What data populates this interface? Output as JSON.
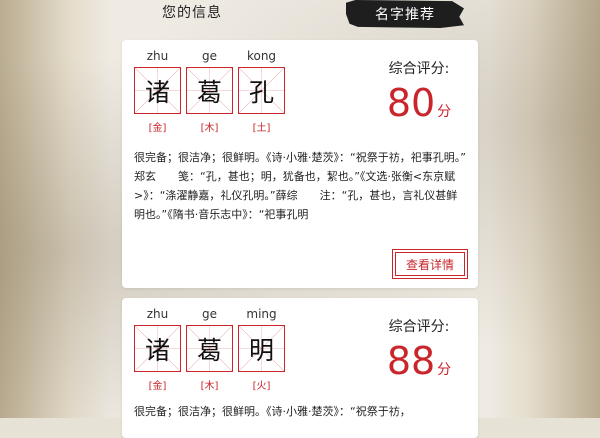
{
  "tabs": {
    "info_label": "您的信息",
    "recommend_label": "名字推荐"
  },
  "colors": {
    "accent_red": "#c9252b",
    "tab_dark": "#1e1e1e"
  },
  "cards": [
    {
      "chars": [
        {
          "pinyin": "zhu",
          "char": "诸",
          "element": "[金]"
        },
        {
          "pinyin": "ge",
          "char": "葛",
          "element": "[木]"
        },
        {
          "pinyin": "kong",
          "char": "孔",
          "element": "[土]"
        }
      ],
      "score_label": "综合评分:",
      "score": "80",
      "score_unit": "分",
      "description": "很完备；很洁净；很鲜明。《诗·小雅·楚茨》：“祝祭于祊，祀事孔明。”　　郑玄　　笺：“孔，甚也；明，犹备也，絜也。”《文选·张衡<东京赋>》：“涤濯静嘉，礼仪孔明。”薛综　　注：“孔，甚也，言礼仪甚鲜明也。”《隋书·音乐志中》：“祀事孔明",
      "detail_label": "查看详情"
    },
    {
      "chars": [
        {
          "pinyin": "zhu",
          "char": "诸",
          "element": "[金]"
        },
        {
          "pinyin": "ge",
          "char": "葛",
          "element": "[木]"
        },
        {
          "pinyin": "ming",
          "char": "明",
          "element": "[火]"
        }
      ],
      "score_label": "综合评分:",
      "score": "88",
      "score_unit": "分",
      "description": "很完备；很洁净；很鲜明。《诗·小雅·楚茨》：“祝祭于祊，"
    }
  ]
}
